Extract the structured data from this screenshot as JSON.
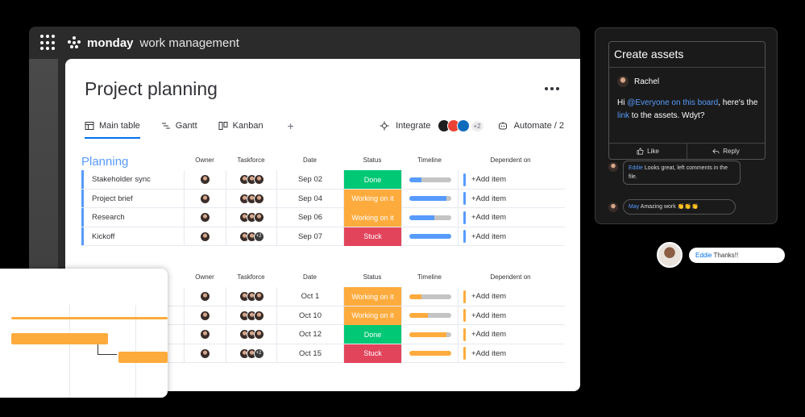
{
  "app": {
    "brand_bold": "monday",
    "brand_rest": "work management"
  },
  "board": {
    "title": "Project planning",
    "tabs": [
      {
        "label": "Main table",
        "icon": "table-icon"
      },
      {
        "label": "Gantt",
        "icon": "gantt-icon"
      },
      {
        "label": "Kanban",
        "icon": "kanban-icon"
      }
    ],
    "add_tab": "+",
    "integrate_label": "Integrate",
    "integrate_count": "+2",
    "automate_label": "Automate / 2"
  },
  "columns": {
    "owner": "Owner",
    "taskforce": "Taskforce",
    "date": "Date",
    "status": "Status",
    "timeline": "Timeline",
    "dependent": "Dependent on"
  },
  "groups": [
    {
      "title": "Planning",
      "color": "#579bfc",
      "rows": [
        {
          "name": "Stakeholder sync",
          "date": "Sep 02",
          "status": "Done",
          "status_color": "#00c875",
          "timeline": 0.3,
          "tl_color": "#579bfc",
          "task_plus": ""
        },
        {
          "name": "Project brief",
          "date": "Sep 04",
          "status": "Working on it",
          "status_color": "#fdab3d",
          "timeline": 0.9,
          "tl_color": "#579bfc",
          "task_plus": ""
        },
        {
          "name": "Research",
          "date": "Sep 06",
          "status": "Working on it",
          "status_color": "#fdab3d",
          "timeline": 0.6,
          "tl_color": "#579bfc",
          "task_plus": ""
        },
        {
          "name": "Kickoff",
          "date": "Sep 07",
          "status": "Stuck",
          "status_color": "#e2445c",
          "timeline": 1.0,
          "tl_color": "#579bfc",
          "task_plus": "+2"
        }
      ]
    },
    {
      "title": "",
      "color": "#fdab3d",
      "rows": [
        {
          "name": "",
          "date": "Oct 1",
          "status": "Working on it",
          "status_color": "#fdab3d",
          "timeline": 0.3,
          "tl_color": "#fdab3d",
          "task_plus": ""
        },
        {
          "name": "",
          "date": "Oct 10",
          "status": "Working on it",
          "status_color": "#fdab3d",
          "timeline": 0.45,
          "tl_color": "#fdab3d",
          "task_plus": ""
        },
        {
          "name": "",
          "date": "Oct 12",
          "status": "Done",
          "status_color": "#00c875",
          "timeline": 0.9,
          "tl_color": "#fdab3d",
          "task_plus": ""
        },
        {
          "name": "",
          "date": "Oct 15",
          "status": "Stuck",
          "status_color": "#e2445c",
          "timeline": 1.0,
          "tl_color": "#fdab3d",
          "task_plus": "+2"
        }
      ]
    }
  ],
  "add_item": "+Add item",
  "assets": {
    "title": "Create assets",
    "author": "Rachel",
    "msg_pre": "Hi ",
    "msg_mention": "@Everyone on this board",
    "msg_mid": ", here's the ",
    "msg_link": "link",
    "msg_post": " to the assets. Wdyt?",
    "like": "Like",
    "reply": "Reply",
    "comment1_name": "Eddie",
    "comment1_text": " Looks great, left comments in the file.",
    "comment2_name": "May",
    "comment2_text": " Amazing work 👏👏👏"
  },
  "eddie": {
    "name": "Eddie",
    "text": " Thanks!!"
  }
}
